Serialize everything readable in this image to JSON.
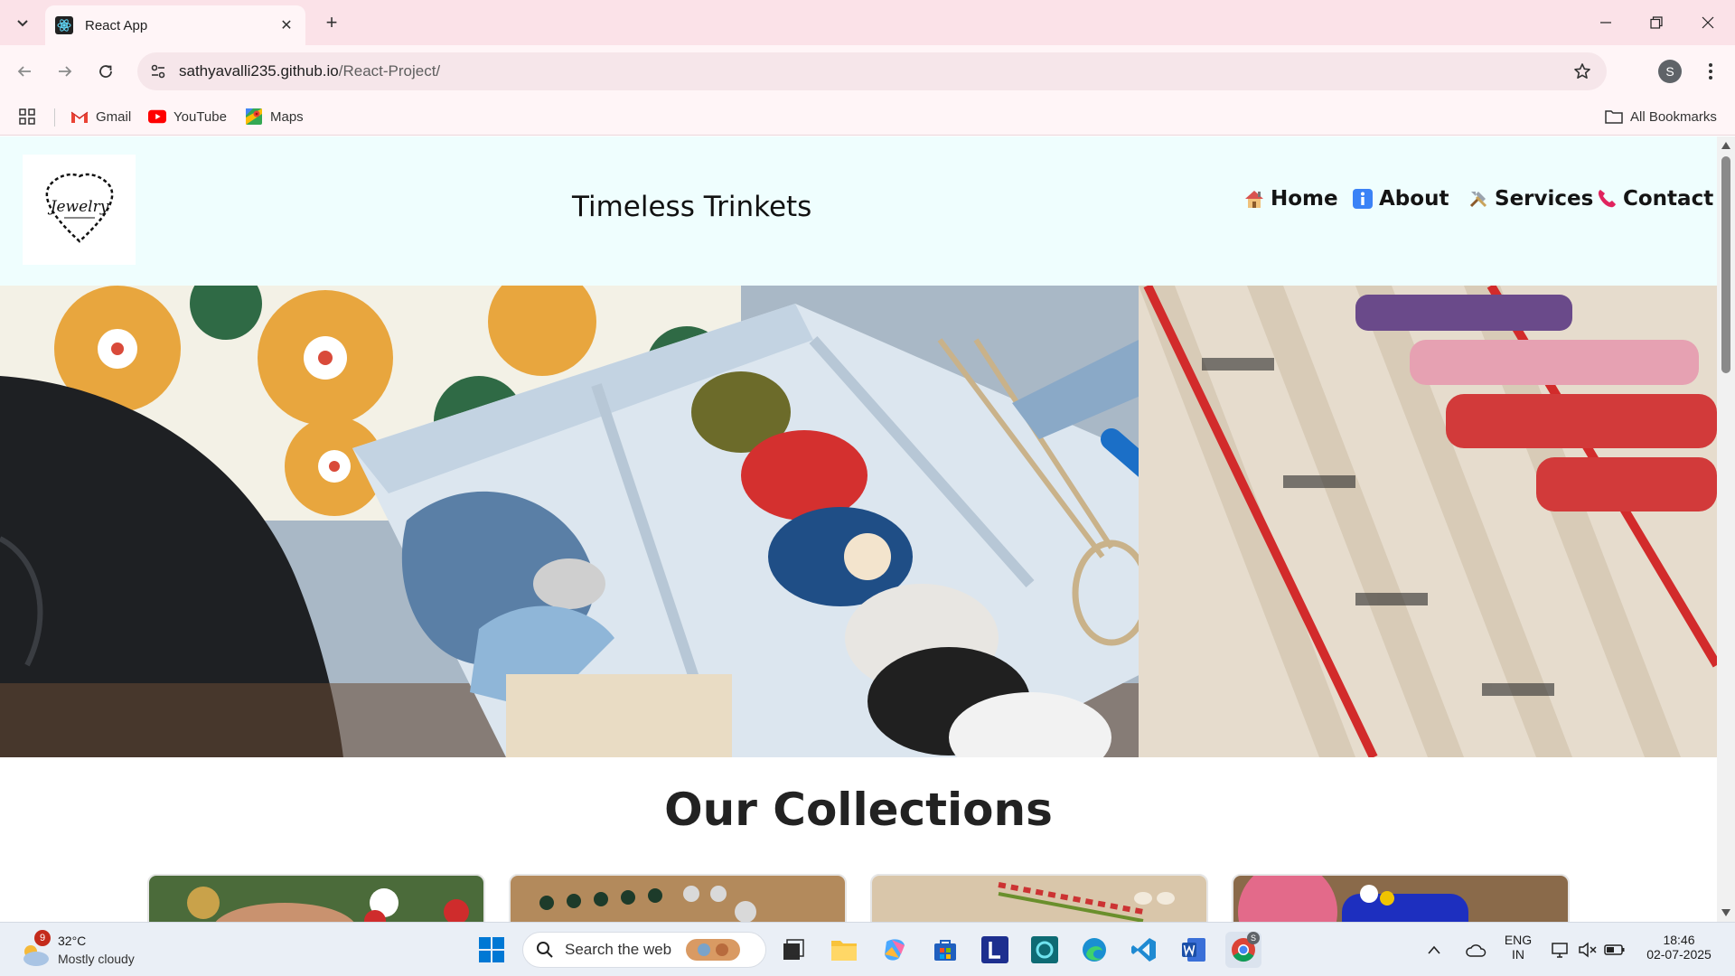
{
  "browser": {
    "tab_title": "React App",
    "url_host": "sathyavalli235.github.io",
    "url_path": "/React-Project/",
    "profile_initial": "S",
    "bookmarks": [
      {
        "label": "Gmail",
        "icon": "gmail-icon"
      },
      {
        "label": "YouTube",
        "icon": "youtube-icon"
      },
      {
        "label": "Maps",
        "icon": "maps-icon"
      }
    ],
    "all_bookmarks_label": "All Bookmarks"
  },
  "site": {
    "logo_text": "Jewelry",
    "title": "Timeless Trinkets",
    "nav": [
      {
        "label": "Home",
        "icon": "house-icon"
      },
      {
        "label": "About",
        "icon": "info-icon"
      },
      {
        "label": "Services",
        "icon": "tools-icon"
      },
      {
        "label": "Contact",
        "icon": "phone-icon"
      }
    ],
    "hero_alt": "Sewing box with thread spools, scissors and ribbons",
    "collections_heading": "Our Collections",
    "collection_cards": 4
  },
  "taskbar": {
    "weather_temp": "32°C",
    "weather_condition": "Mostly cloudy",
    "weather_badge": "9",
    "search_placeholder": "Search the web",
    "language_line1": "ENG",
    "language_line2": "IN",
    "time": "18:46",
    "date": "02-07-2025",
    "chrome_badge": "S"
  },
  "colors": {
    "tabstrip": "#fbe2e8",
    "toolbar": "#fff5f7",
    "site_header": "#effefe",
    "taskbar": "#eaeff6"
  }
}
